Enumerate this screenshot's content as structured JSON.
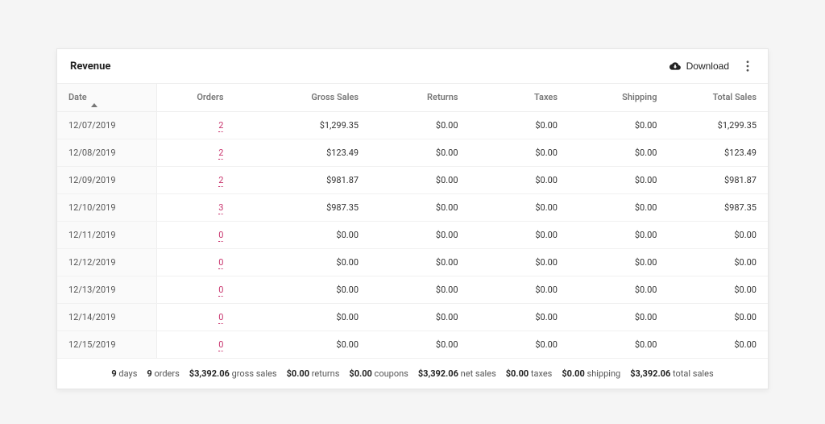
{
  "header": {
    "title": "Revenue",
    "download_label": "Download"
  },
  "columns": {
    "date": "Date",
    "orders": "Orders",
    "gross": "Gross Sales",
    "returns": "Returns",
    "taxes": "Taxes",
    "shipping": "Shipping",
    "total": "Total Sales"
  },
  "rows": [
    {
      "date": "12/07/2019",
      "orders": "2",
      "gross": "$1,299.35",
      "returns": "$0.00",
      "taxes": "$0.00",
      "shipping": "$0.00",
      "total": "$1,299.35"
    },
    {
      "date": "12/08/2019",
      "orders": "2",
      "gross": "$123.49",
      "returns": "$0.00",
      "taxes": "$0.00",
      "shipping": "$0.00",
      "total": "$123.49"
    },
    {
      "date": "12/09/2019",
      "orders": "2",
      "gross": "$981.87",
      "returns": "$0.00",
      "taxes": "$0.00",
      "shipping": "$0.00",
      "total": "$981.87"
    },
    {
      "date": "12/10/2019",
      "orders": "3",
      "gross": "$987.35",
      "returns": "$0.00",
      "taxes": "$0.00",
      "shipping": "$0.00",
      "total": "$987.35"
    },
    {
      "date": "12/11/2019",
      "orders": "0",
      "gross": "$0.00",
      "returns": "$0.00",
      "taxes": "$0.00",
      "shipping": "$0.00",
      "total": "$0.00"
    },
    {
      "date": "12/12/2019",
      "orders": "0",
      "gross": "$0.00",
      "returns": "$0.00",
      "taxes": "$0.00",
      "shipping": "$0.00",
      "total": "$0.00"
    },
    {
      "date": "12/13/2019",
      "orders": "0",
      "gross": "$0.00",
      "returns": "$0.00",
      "taxes": "$0.00",
      "shipping": "$0.00",
      "total": "$0.00"
    },
    {
      "date": "12/14/2019",
      "orders": "0",
      "gross": "$0.00",
      "returns": "$0.00",
      "taxes": "$0.00",
      "shipping": "$0.00",
      "total": "$0.00"
    },
    {
      "date": "12/15/2019",
      "orders": "0",
      "gross": "$0.00",
      "returns": "$0.00",
      "taxes": "$0.00",
      "shipping": "$0.00",
      "total": "$0.00"
    }
  ],
  "summary": [
    {
      "value": "9",
      "label": "days"
    },
    {
      "value": "9",
      "label": "orders"
    },
    {
      "value": "$3,392.06",
      "label": "gross sales"
    },
    {
      "value": "$0.00",
      "label": "returns"
    },
    {
      "value": "$0.00",
      "label": "coupons"
    },
    {
      "value": "$3,392.06",
      "label": "net sales"
    },
    {
      "value": "$0.00",
      "label": "taxes"
    },
    {
      "value": "$0.00",
      "label": "shipping"
    },
    {
      "value": "$3,392.06",
      "label": "total sales"
    }
  ]
}
